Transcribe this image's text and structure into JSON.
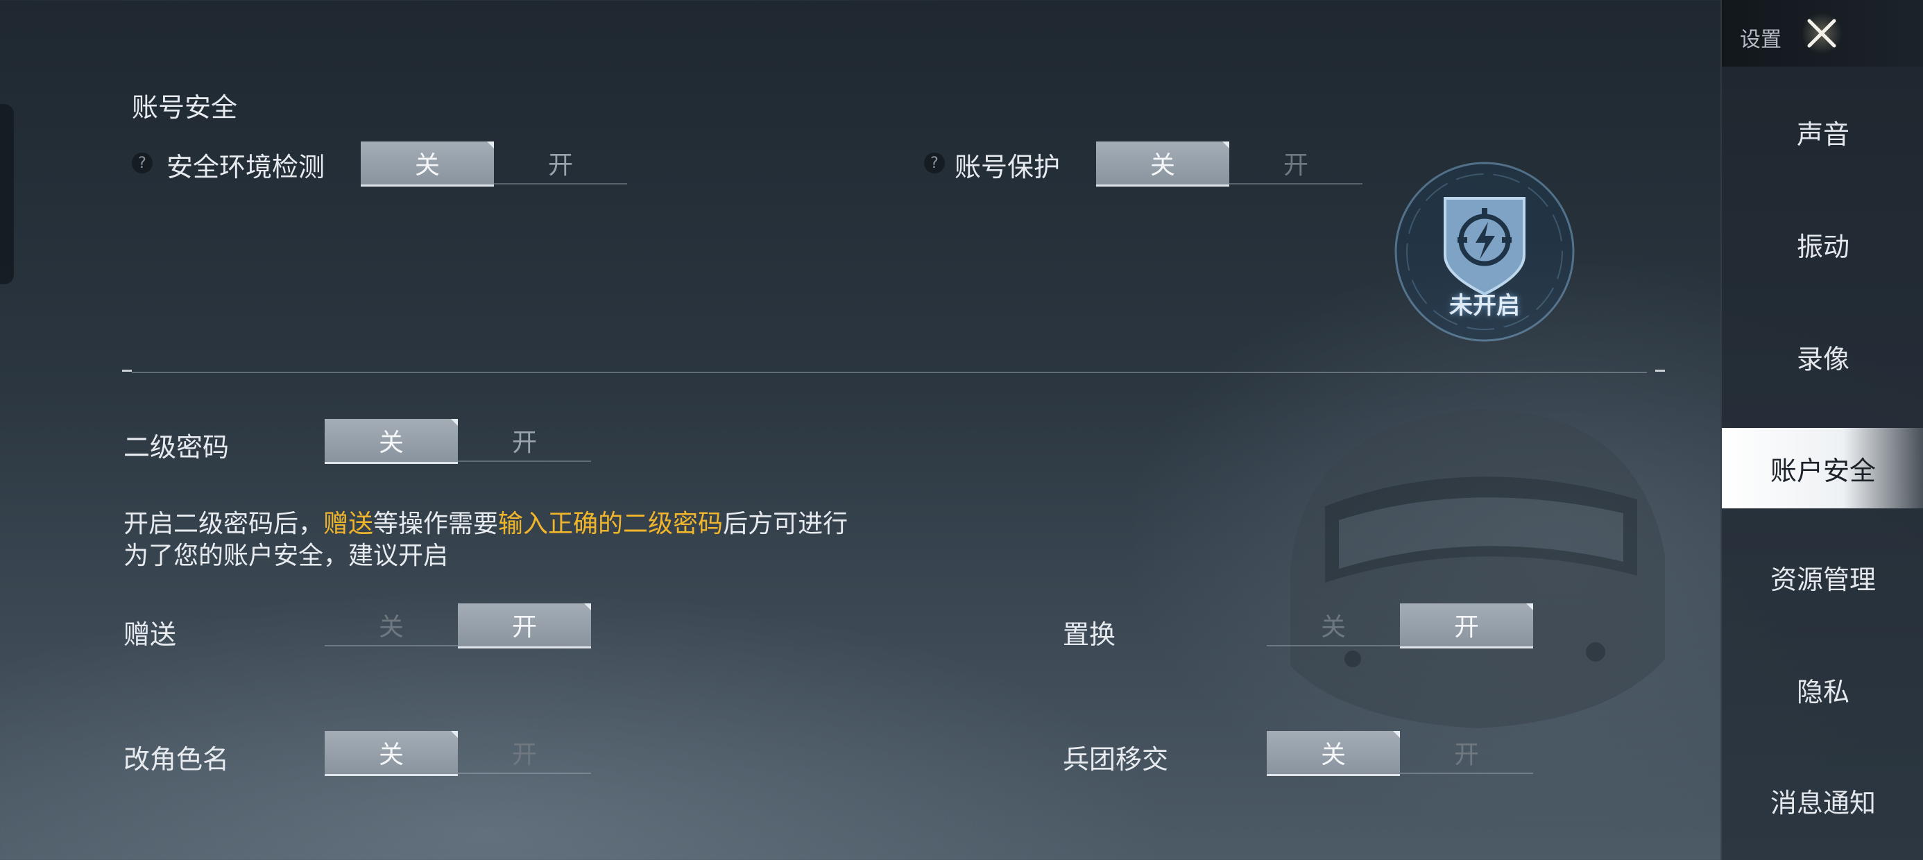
{
  "sidebar": {
    "title": "设置",
    "items": [
      {
        "label": "声音",
        "active": false
      },
      {
        "label": "振动",
        "active": false
      },
      {
        "label": "录像",
        "active": false
      },
      {
        "label": "账户安全",
        "active": true
      },
      {
        "label": "资源管理",
        "active": false
      },
      {
        "label": "隐私",
        "active": false
      },
      {
        "label": "消息通知",
        "active": false
      }
    ]
  },
  "account_security": {
    "title": "账号安全",
    "env_check": {
      "label": "安全环境检测",
      "off": "关",
      "on": "开",
      "state": "off"
    },
    "account_protect": {
      "label": "账号保护",
      "off": "关",
      "on": "开",
      "state": "off"
    },
    "badge_status": "未开启"
  },
  "secondary_password": {
    "label": "二级密码",
    "off": "关",
    "on": "开",
    "state": "off",
    "desc_line1_a": "开启二级密码后，",
    "desc_line1_hl1": "赠送",
    "desc_line1_b": "等操作需要",
    "desc_line1_hl2": "输入正确的二级密码",
    "desc_line1_c": "后方可进行",
    "desc_line2": "为了您的账户安全，建议开启",
    "highlight_color": "#f0b52b"
  },
  "options": [
    {
      "label": "赠送",
      "off": "关",
      "on": "开",
      "state": "on"
    },
    {
      "label": "置换",
      "off": "关",
      "on": "开",
      "state": "on"
    },
    {
      "label": "改角色名",
      "off": "关",
      "on": "开",
      "state": "off"
    },
    {
      "label": "兵团移交",
      "off": "关",
      "on": "开",
      "state": "off"
    }
  ]
}
